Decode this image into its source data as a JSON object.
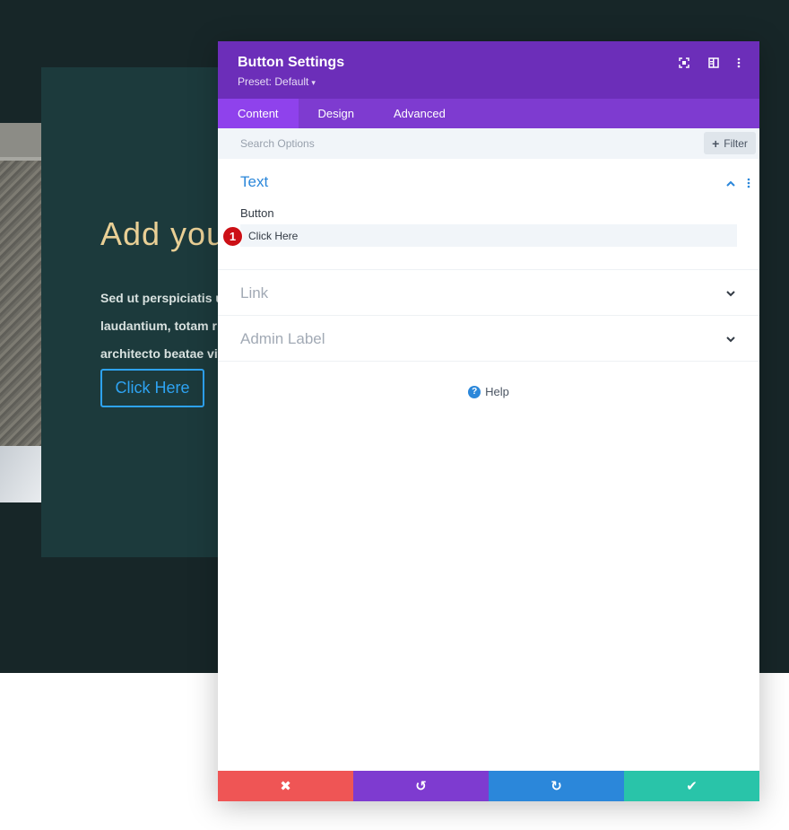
{
  "background": {
    "heading": "Add you",
    "paragraph_lines": [
      "Sed ut perspiciatis u",
      "laudantium, totam r",
      "architecto beatae vit"
    ],
    "button_label": "Click Here"
  },
  "modal": {
    "title": "Button Settings",
    "preset": "Preset: Default",
    "header_icons": [
      "expand-icon",
      "split-view-icon",
      "more-vertical-icon"
    ],
    "tabs": [
      {
        "label": "Content",
        "active": true
      },
      {
        "label": "Design",
        "active": false
      },
      {
        "label": "Advanced",
        "active": false
      }
    ],
    "search": {
      "placeholder": "Search Options"
    },
    "filter_label": "Filter",
    "sections": {
      "text": {
        "title": "Text",
        "field_label": "Button",
        "field_value": "Click Here",
        "badge": "1"
      },
      "link": {
        "title": "Link"
      },
      "admin_label": {
        "title": "Admin Label"
      }
    },
    "help_label": "Help",
    "footer": [
      {
        "name": "cancel",
        "icon": "✖",
        "color": "#ef5555"
      },
      {
        "name": "undo",
        "icon": "↺",
        "color": "#7e3bd0"
      },
      {
        "name": "redo",
        "icon": "↻",
        "color": "#2b87da"
      },
      {
        "name": "save",
        "icon": "✔",
        "color": "#29c4a9"
      }
    ]
  }
}
